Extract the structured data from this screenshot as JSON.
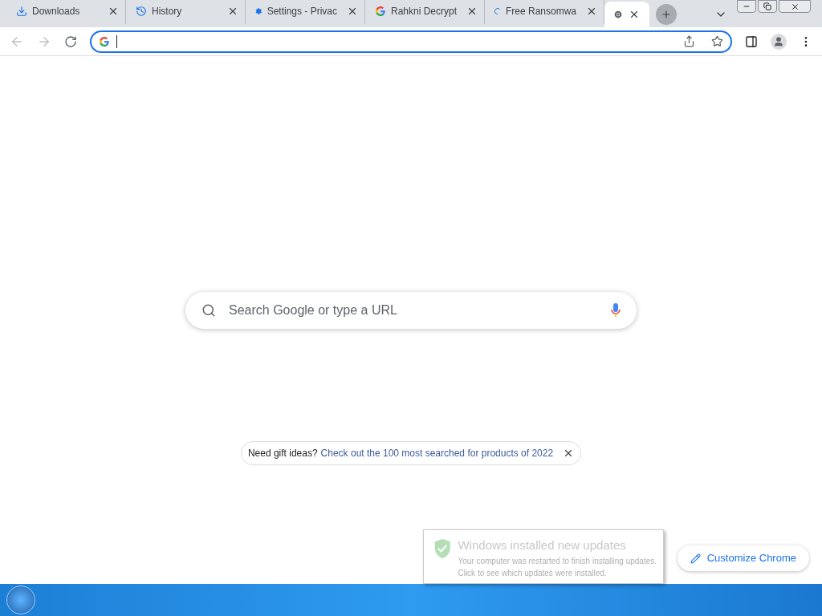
{
  "tabs": [
    {
      "kind": "download",
      "title": "Downloads",
      "selected": false
    },
    {
      "kind": "history",
      "title": "History",
      "selected": false
    },
    {
      "kind": "gear",
      "title": "Settings - Privac",
      "selected": false
    },
    {
      "kind": "google",
      "title": "Rahkni Decrypt",
      "selected": false
    },
    {
      "kind": "loading",
      "title": "Free Ransomwa",
      "selected": false
    },
    {
      "kind": "chrome",
      "selected": true
    }
  ],
  "search": {
    "placeholder": "Search Google or type a URL"
  },
  "promo": {
    "lead": "Need gift ideas?",
    "link": "Check out the 100 most searched for products of 2022"
  },
  "customize_button": "Customize Chrome",
  "notification": {
    "title": "Windows installed new updates",
    "lines": [
      "Your computer was restarted to finish installing updates.",
      "Click to see which updates were installed."
    ]
  }
}
